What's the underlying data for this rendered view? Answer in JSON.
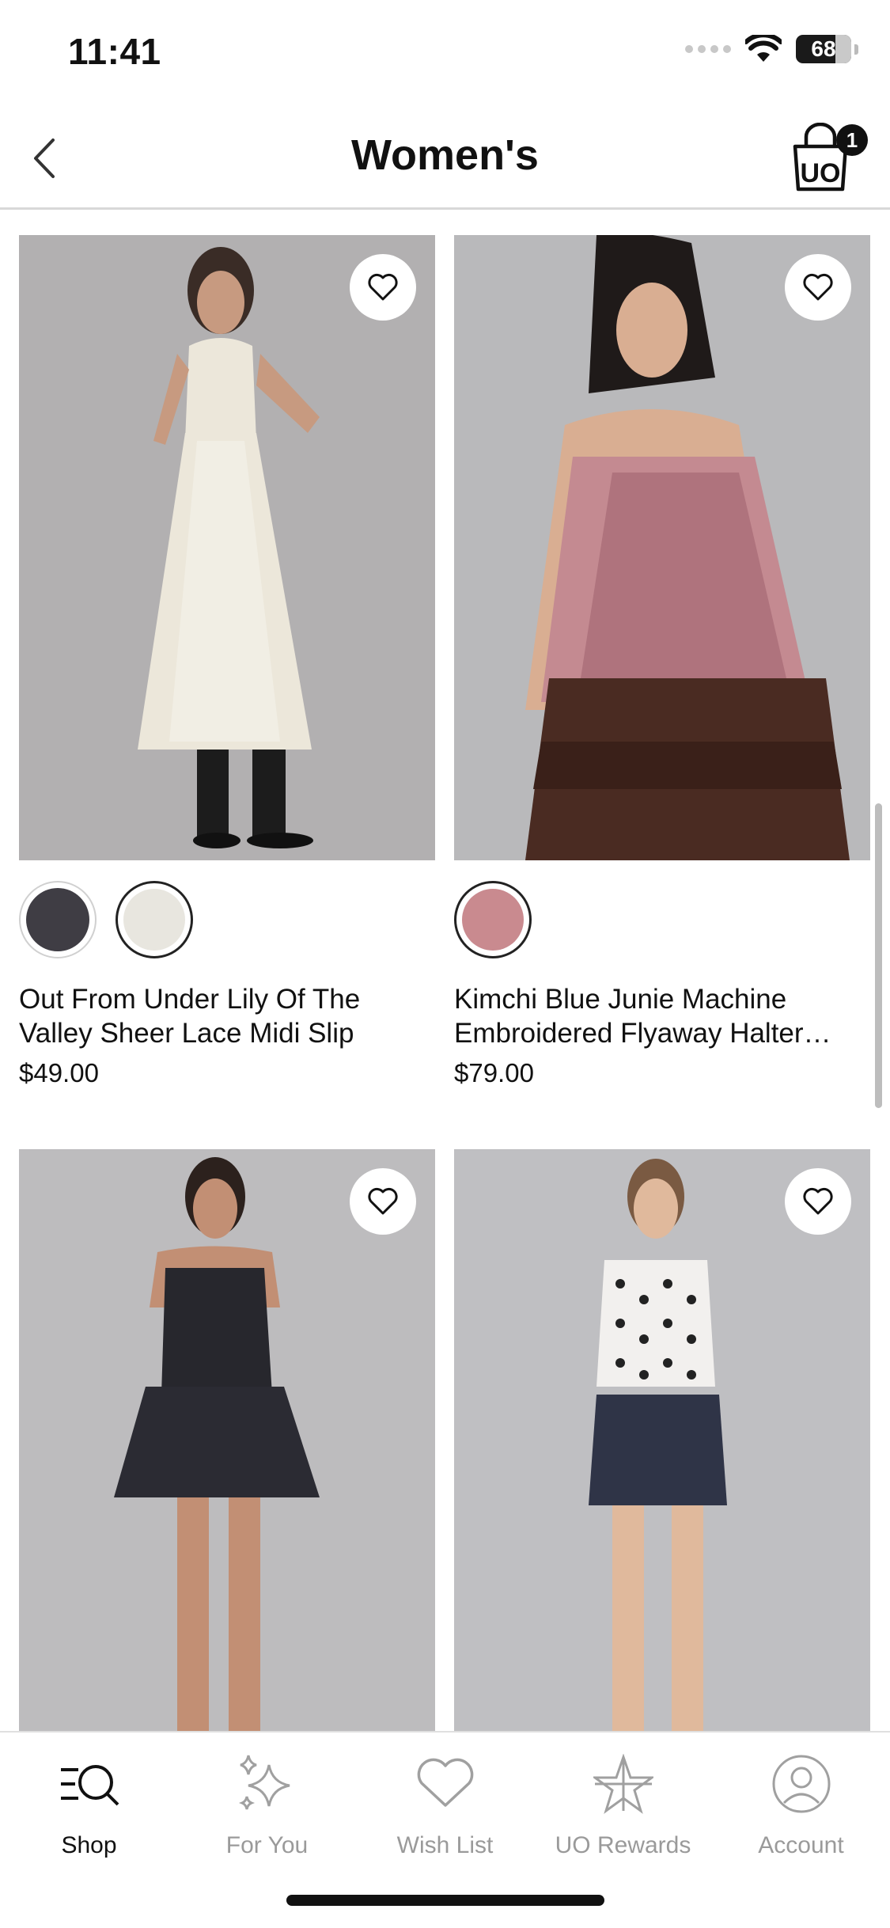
{
  "status_bar": {
    "time": "11:41",
    "battery": "68"
  },
  "header": {
    "title": "Women's",
    "cart_count": "1",
    "cart_logo": "UO"
  },
  "products": [
    {
      "name_line1": "Out From Under Lily Of The",
      "name_line2": "Valley Sheer Lace Midi Slip",
      "price": "$49.00",
      "swatches": [
        "#3f3d44",
        "#e8e6df"
      ]
    },
    {
      "name_line1": "Kimchi Blue Junie Machine",
      "name_line2": "Embroidered Flyaway Halter…",
      "price": "$79.00",
      "swatches": [
        "#c98a8f"
      ]
    },
    {
      "name_line1": "",
      "name_line2": "",
      "price": "",
      "swatches": []
    },
    {
      "name_line1": "",
      "name_line2": "",
      "price": "",
      "swatches": []
    }
  ],
  "tabs": [
    {
      "label": "Shop",
      "icon": "shop-search-icon",
      "active": true
    },
    {
      "label": "For You",
      "icon": "sparkles-icon",
      "active": false
    },
    {
      "label": "Wish List",
      "icon": "heart-icon",
      "active": false
    },
    {
      "label": "UO Rewards",
      "icon": "rewards-star-icon",
      "active": false
    },
    {
      "label": "Account",
      "icon": "account-icon",
      "active": false
    }
  ],
  "colors": {
    "accent": "#111111",
    "inactive_tab": "#9a9a9a",
    "photo_bg": "#b9b7b7"
  }
}
